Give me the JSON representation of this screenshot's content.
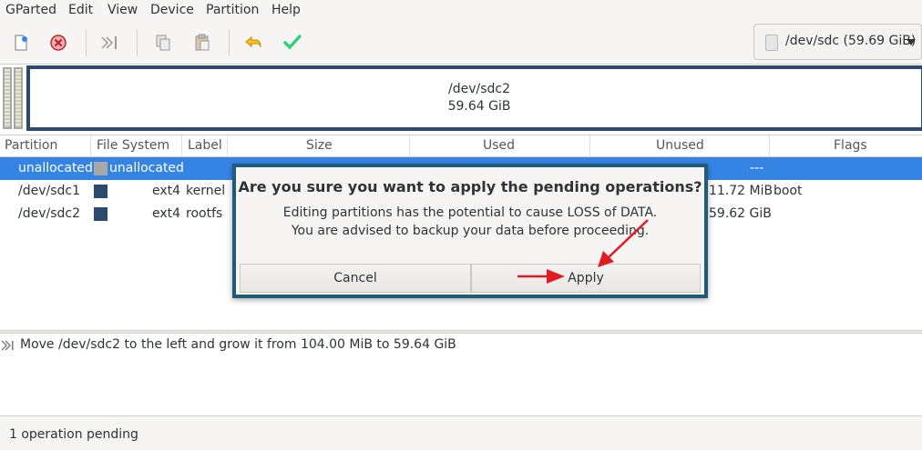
{
  "menu": {
    "items": [
      "GParted",
      "Edit",
      "View",
      "Device",
      "Partition",
      "Help"
    ]
  },
  "toolbar": {
    "icons": [
      "new-icon",
      "delete-icon",
      "resize-move-icon",
      "copy-icon",
      "paste-icon",
      "undo-icon",
      "apply-icon"
    ]
  },
  "device_selector": {
    "label": "/dev/sdc (59.69 GiB)"
  },
  "partition_bar": {
    "name": "/dev/sdc2",
    "size": "59.64 GiB"
  },
  "table": {
    "headers": [
      "Partition",
      "File System",
      "Label",
      "Size",
      "Used",
      "Unused",
      "Flags"
    ],
    "rows": [
      {
        "partition": "unallocated",
        "fs": "unallocated",
        "label": "",
        "size": "",
        "used": "",
        "unused": "---",
        "flags": "",
        "color": "#a8a8a8",
        "selected": true
      },
      {
        "partition": "/dev/sdc1",
        "fs": "ext4",
        "label": "kernel",
        "size": "",
        "used": "",
        "unused": "11.72 MiB",
        "flags": "boot",
        "color": "#2c4a6e",
        "selected": false
      },
      {
        "partition": "/dev/sdc2",
        "fs": "ext4",
        "label": "rootfs",
        "size": "",
        "used": "",
        "unused": "59.62 GiB",
        "flags": "",
        "color": "#2c4a6e",
        "selected": false
      }
    ]
  },
  "operations": {
    "items": [
      "Move /dev/sdc2 to the left and grow it from 104.00 MiB to 59.64 GiB"
    ]
  },
  "status": {
    "text": "1 operation pending"
  },
  "dialog": {
    "title": "Are you sure you want to apply the pending operations?",
    "line1": "Editing partitions has the potential to cause LOSS of DATA.",
    "line2": "You are advised to backup your data before proceeding.",
    "cancel_label": "Cancel",
    "apply_label": "Apply"
  },
  "colors": {
    "selection": "#3584e4",
    "partition_border": "#2c4a6e",
    "dialog_border": "#1f5a76",
    "annotation_arrow": "#e01b24"
  }
}
